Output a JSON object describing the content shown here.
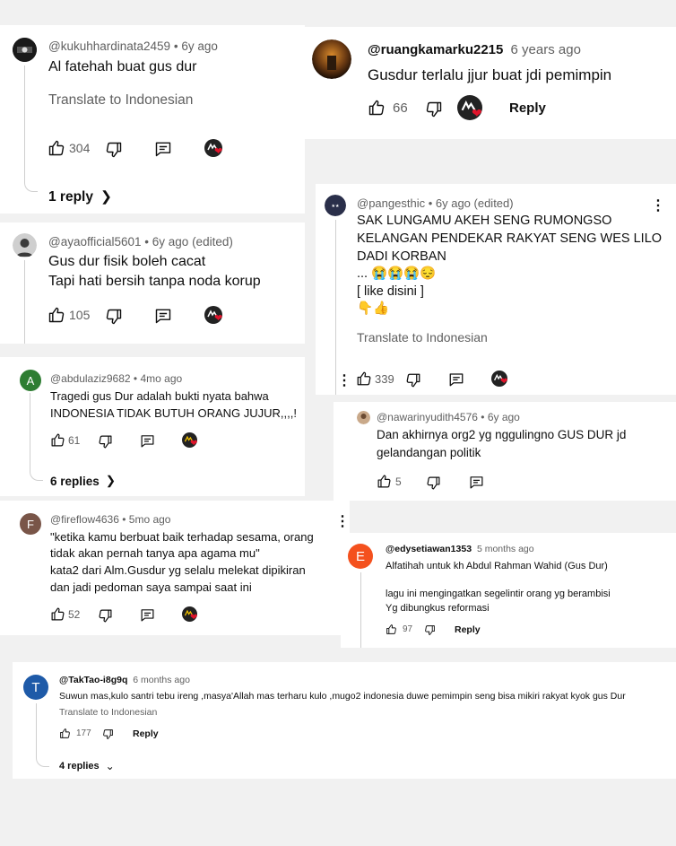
{
  "c1": {
    "handle": "@kukuhhardinata2459",
    "time": "6y ago",
    "text": "Al fatehah buat  gus dur",
    "translate": "Translate to Indonesian",
    "likes": "304",
    "replies": "1 reply"
  },
  "c2": {
    "handle": "@ruangkamarku2215",
    "time": "6 years ago",
    "text": "Gusdur terlalu jjur buat jdi pemimpin",
    "likes": "66",
    "reply": "Reply"
  },
  "c3": {
    "handle": "@ayaofficial5601",
    "time": "6y ago (edited)",
    "lines": [
      "Gus dur fisik boleh cacat",
      "Tapi hati bersih tanpa noda korup"
    ],
    "likes": "105"
  },
  "c4": {
    "handle": "@pangesthic",
    "time": "6y ago (edited)",
    "lines": [
      "SAK LUNGAMU AKEH SENG RUMONGSO",
      "KELANGAN PENDEKAR RAKYAT SENG WES LILO",
      "DADI KORBAN",
      "... 😭😭😭😔",
      "[ like disini ]",
      "👇👍"
    ],
    "translate": "Translate to Indonesian",
    "likes": "339"
  },
  "c5": {
    "avatar_letter": "A",
    "avatar_color": "#2e7d32",
    "handle": "@abdulaziz9682",
    "time": "4mo ago",
    "lines": [
      "Tragedi gus Dur adalah bukti nyata bahwa",
      "INDONESIA TIDAK BUTUH ORANG JUJUR,,,,!"
    ],
    "likes": "61",
    "replies": "6 replies"
  },
  "c6": {
    "handle": "@nawarinyudith4576",
    "time": "6y ago",
    "lines": [
      "Dan akhirnya org2 yg nggulingno GUS DUR jd",
      "gelandangan politik"
    ],
    "likes": "5"
  },
  "c7": {
    "avatar_letter": "F",
    "avatar_color": "#795548",
    "handle": "@fireflow4636",
    "time": "5mo ago",
    "lines": [
      "\"ketika kamu berbuat baik terhadap sesama, orang",
      "tidak akan pernah tanya apa agama mu\"",
      "kata2 dari Alm.Gusdur yg selalu melekat dipikiran",
      "dan jadi pedoman saya sampai saat ini"
    ],
    "likes": "52"
  },
  "c8": {
    "avatar_letter": "E",
    "avatar_color": "#f4511e",
    "handle": "@edysetiawan1353",
    "time": "5 months ago",
    "lines": [
      "Alfatihah untuk kh Abdul Rahman Wahid (Gus Dur)",
      "",
      "lagu ini mengingatkan segelintir orang yg berambisi",
      "Yg dibungkus reformasi"
    ],
    "likes": "97",
    "reply": "Reply"
  },
  "c9": {
    "avatar_letter": "T",
    "avatar_color": "#1e5aa8",
    "handle": "@TakTao-i8g9q",
    "time": "6 months ago",
    "text": "Suwun mas,kulo santri tebu ireng ,masya'Allah mas terharu kulo ,mugo2 indonesia duwe pemimpin seng bisa mikiri rakyat kyok gus Dur",
    "translate": "Translate to Indonesian",
    "likes": "177",
    "reply": "Reply",
    "replies": "4 replies"
  },
  "icons": {
    "like": "thumbs-up-icon",
    "dislike": "thumbs-down-icon",
    "reply": "comment-reply-icon",
    "more": "more-vert-icon",
    "chevron_right": "chevron-right-icon",
    "chevron_down": "chevron-down-icon",
    "heart": "heart-icon"
  },
  "colors": {
    "heart": "#e0142b",
    "meta": "#606060",
    "text": "#0f0f0f"
  }
}
